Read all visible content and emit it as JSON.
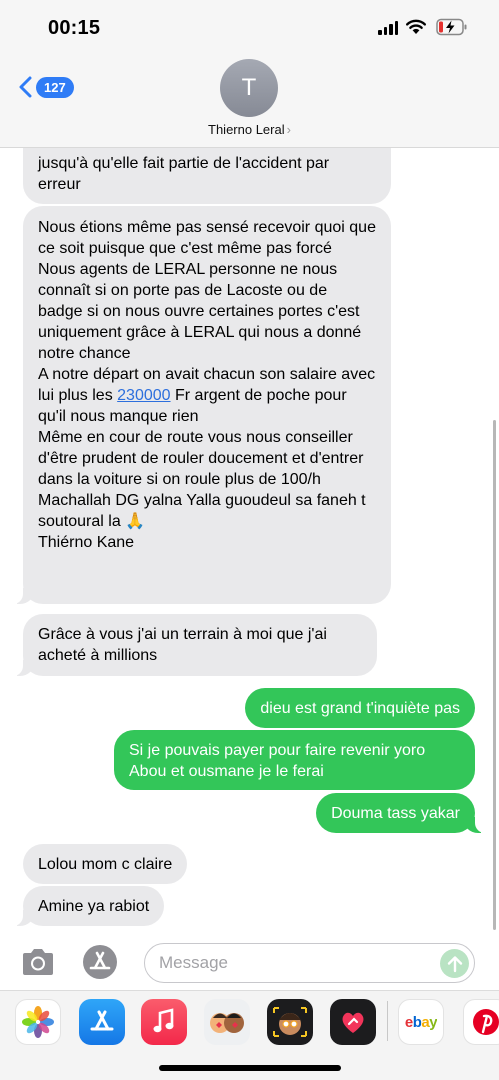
{
  "status_bar": {
    "time": "00:15"
  },
  "header": {
    "back_count": "127",
    "avatar_initial": "T",
    "contact_name": "Thierno Leral",
    "chevron": "›"
  },
  "messages": [
    {
      "dir": "in",
      "text": "jusqu'à qu'elle fait partie de l'accident par erreur"
    },
    {
      "dir": "in",
      "part1": "Nous étions même pas sensé recevoir quoi que ce soit puisque que c'est même pas forcé\nNous agents de LERAL personne ne nous connaît si on porte pas de Lacoste ou de badge si on nous ouvre certaines portes c'est uniquement grâce à LERAL qui nous a donné notre chance\nA notre départ on avait chacun son salaire avec lui plus les ",
      "link": "230000",
      "part2": " Fr argent de poche pour qu'il nous manque rien\nMême en cour de route vous nous conseiller d'être prudent de rouler doucement et d'entrer dans la voiture si on roule plus de 100/h\nMachallah DG yalna Yalla guoudeul sa faneh t soutoural la 🙏\nThiérno Kane"
    },
    {
      "dir": "in",
      "text": "Grâce à vous j'ai un terrain à moi que j'ai acheté à millions"
    },
    {
      "dir": "out",
      "text": "dieu est grand t'inquiète pas"
    },
    {
      "dir": "out",
      "text": "Si je pouvais payer pour faire revenir yoro Abou et ousmane je le ferai"
    },
    {
      "dir": "out",
      "text": "Douma tass yakar"
    },
    {
      "dir": "in",
      "text": "Lolou mom c claire"
    },
    {
      "dir": "in",
      "text": "Amine ya rabiot"
    }
  ],
  "composer": {
    "placeholder": "Message"
  },
  "app_drawer": {
    "apps": [
      {
        "name": "photos-icon"
      },
      {
        "name": "app-store-icon"
      },
      {
        "name": "music-icon"
      },
      {
        "name": "memoji-stickers-icon"
      },
      {
        "name": "memoji-icon"
      },
      {
        "name": "digital-touch-icon"
      },
      {
        "name": "ebay-icon",
        "label": "ebay"
      },
      {
        "name": "pinterest-icon"
      }
    ]
  },
  "colors": {
    "incoming": "#e9e9eb",
    "outgoing": "#33c659",
    "accent": "#2f7cf6"
  }
}
